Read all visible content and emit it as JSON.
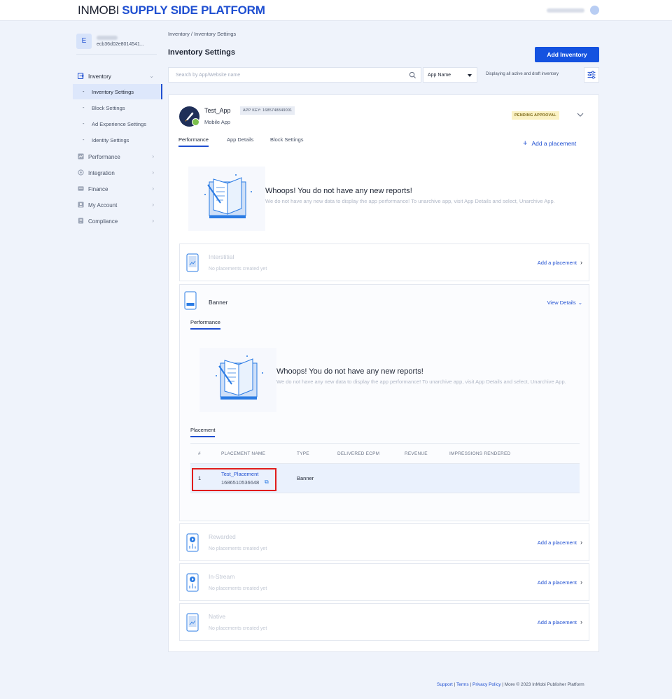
{
  "brand": {
    "part1": "INMOBI",
    "part2": "SUPPLY SIDE PLATFORM"
  },
  "account": {
    "initial": "E",
    "id": "ecb36d02e8014541..."
  },
  "sidebar": {
    "items": [
      {
        "label": "Inventory",
        "icon": "inventory-icon"
      },
      {
        "label": "Performance",
        "icon": "performance-icon"
      },
      {
        "label": "Integration",
        "icon": "integration-icon"
      },
      {
        "label": "Finance",
        "icon": "finance-icon"
      },
      {
        "label": "My Account",
        "icon": "account-icon"
      },
      {
        "label": "Compliance",
        "icon": "compliance-icon"
      }
    ],
    "sub_items": [
      {
        "label": "Inventory Settings"
      },
      {
        "label": "Block Settings"
      },
      {
        "label": "Ad Experience Settings"
      },
      {
        "label": "Identity Settings"
      }
    ]
  },
  "breadcrumb": "Inventory / Inventory Settings",
  "page_title": "Inventory Settings",
  "add_inventory_label": "Add Inventory",
  "search": {
    "placeholder": "Search by App/Website name"
  },
  "select": {
    "value": "App Name"
  },
  "display_note": "Displaying all active and draft inventory",
  "app": {
    "name": "Test_App",
    "key": "APP KEY: 1685748849001",
    "type": "Mobile App",
    "status": "PENDING APPROVAL",
    "tabs": [
      "Performance",
      "App Details",
      "Block Settings"
    ],
    "add_placement": "Add a placement"
  },
  "empty_state": {
    "title": "Whoops! You do not have any new reports!",
    "desc": "We do not have any new data to display the app performance! To unarchive app, visit App Details and select, Unarchive App."
  },
  "placements": {
    "interstitial": {
      "title": "Interstitial",
      "sub": "No placements created yet",
      "action": "Add a placement"
    },
    "banner": {
      "title": "Banner",
      "action": "View Details",
      "perf_tab": "Performance",
      "placement_tab": "Placement"
    },
    "rewarded": {
      "title": "Rewarded",
      "sub": "No placements created yet",
      "action": "Add a placement"
    },
    "instream": {
      "title": "In-Stream",
      "sub": "No placements created yet",
      "action": "Add a placement"
    },
    "native": {
      "title": "Native",
      "sub": "No placements created yet",
      "action": "Add a placement"
    }
  },
  "table": {
    "headers": [
      "#",
      "PLACEMENT NAME",
      "TYPE",
      "DELIVERED ECPM",
      "REVENUE",
      "IMPRESSIONS RENDERED"
    ],
    "rows": [
      {
        "index": "1",
        "name": "Test_Placement",
        "id": "1686510536648",
        "type": "Banner"
      }
    ]
  },
  "footer": {
    "support": "Support",
    "sep1": " | ",
    "terms": "Terms",
    "sep2": " | ",
    "privacy": "Privacy Policy",
    "rest": " | More © 2023 InMobi Publisher Platform"
  },
  "colors": {
    "accent": "#1f4fd1",
    "button": "#1452e0",
    "highlight": "#e01c1c",
    "pending_bg": "#fbf2c4"
  }
}
